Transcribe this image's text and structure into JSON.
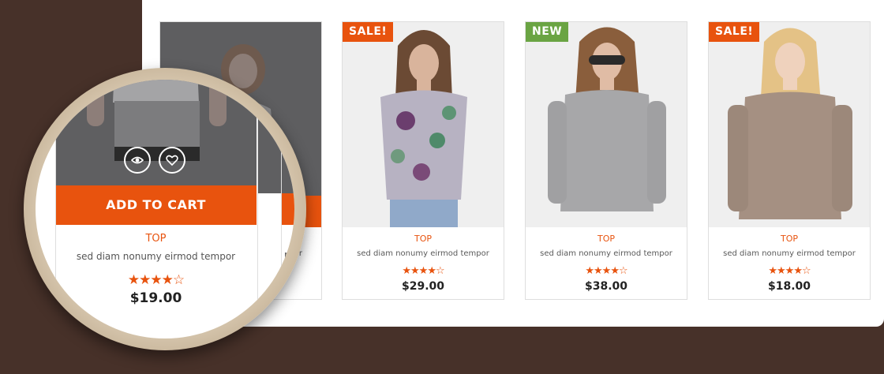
{
  "products": [
    {
      "badge": "",
      "category": "TOP",
      "description": "sed diam nonumy eirmod tempor",
      "stars": "★★★★☆",
      "rating": 4,
      "price": "$19.00"
    },
    {
      "badge": "SALE!",
      "category": "TOP",
      "description": "sed diam nonumy eirmod tempor",
      "stars": "★★★★☆",
      "rating": 4,
      "price": "$29.00"
    },
    {
      "badge": "NEW",
      "category": "TOP",
      "description": "sed diam nonumy eirmod tempor",
      "stars": "★★★★☆",
      "rating": 4,
      "price": "$38.00"
    },
    {
      "badge": "SALE!",
      "category": "TOP",
      "description": "sed diam nonumy eirmod tempor",
      "stars": "★★★★☆",
      "rating": 4,
      "price": "$18.00"
    }
  ],
  "magnified": {
    "add_to_cart_label": "ADD TO CART",
    "category": "TOP",
    "description": "sed diam nonumy eirmod tempor",
    "stars": "★★★★☆",
    "price": "$19.00",
    "partial_text": "r"
  },
  "icons": {
    "quick_view": "eye-icon",
    "wishlist": "heart-icon"
  },
  "colors": {
    "accent": "#e8530e",
    "new_badge": "#6aa443",
    "background": "#473129"
  }
}
